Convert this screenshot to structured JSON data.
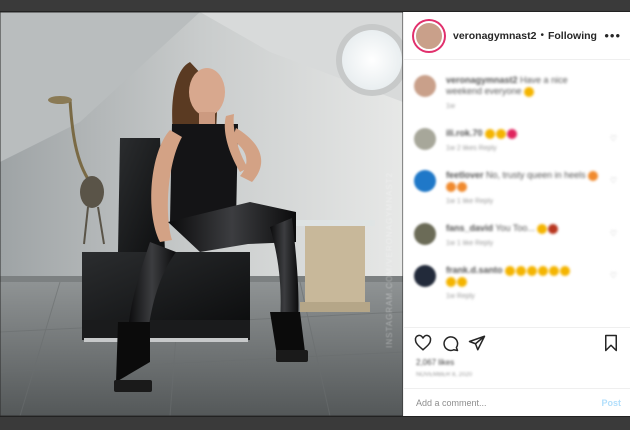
{
  "post": {
    "username": "veronagymnast2",
    "separator": "•",
    "follow_status": "Following",
    "more_icon": "more-dots-icon",
    "caption": {
      "user": "veronagymnast2",
      "text": "Have a nice weekend everyone",
      "meta": "1w"
    }
  },
  "comments": [
    {
      "user": "ili.rok.70",
      "text": "",
      "meta": "1w  2 likes  Reply",
      "emoji_count": 2,
      "avatar_color": "#a7a79a"
    },
    {
      "user": "feetlover",
      "text": "No, trusty queen in heels",
      "meta": "1w  1 like  Reply",
      "emoji_count": 3,
      "avatar_color": "#1f78c8"
    },
    {
      "user": "fans_david",
      "text": "You Too...",
      "meta": "1w  1 like  Reply",
      "emoji_count": 2,
      "avatar_color": "#6b6b57"
    },
    {
      "user": "frank.d.santo",
      "text": "",
      "meta": "1w  Reply",
      "emoji_count": 6,
      "avatar_color": "#222a3a"
    }
  ],
  "actions": {
    "like_icon": "heart-icon",
    "comment_icon": "comment-bubble-icon",
    "share_icon": "paper-plane-icon",
    "save_icon": "bookmark-icon"
  },
  "likes": "2,067 likes",
  "date": "NOVEMBER 8, 2020",
  "add_comment": {
    "placeholder": "Add a comment...",
    "post_label": "Post"
  },
  "watermark": "INSTAGRAM.COM/VERONAGYMNAST2",
  "colors": {
    "accent_blue": "#0095f6",
    "story_ring": "#e1306c"
  }
}
